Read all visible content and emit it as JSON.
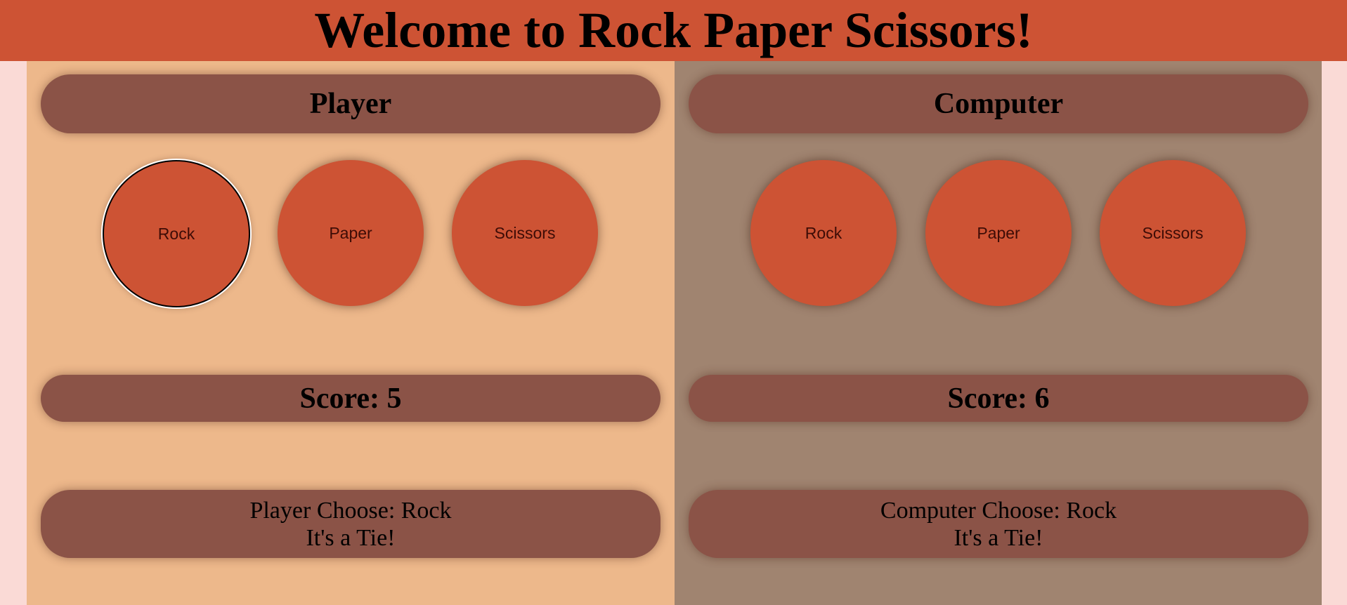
{
  "header": {
    "title": "Welcome to Rock Paper Scissors!"
  },
  "player": {
    "title": "Player",
    "choices": [
      "Rock",
      "Paper",
      "Scissors"
    ],
    "selected": "Rock",
    "score_label": "Score: 5",
    "result_choice": "Player Choose: Rock",
    "result_outcome": "It's a Tie!"
  },
  "computer": {
    "title": "Computer",
    "choices": [
      "Rock",
      "Paper",
      "Scissors"
    ],
    "score_label": "Score: 6",
    "result_choice": "Computer Choose: Rock",
    "result_outcome": "It's a Tie!"
  },
  "colors": {
    "page_background": "#fadad6",
    "header_background": "#cd5334",
    "player_panel": "#edb88b",
    "computer_panel": "#a08470",
    "pill": "#8b5347",
    "choice_button": "#cd5334"
  }
}
